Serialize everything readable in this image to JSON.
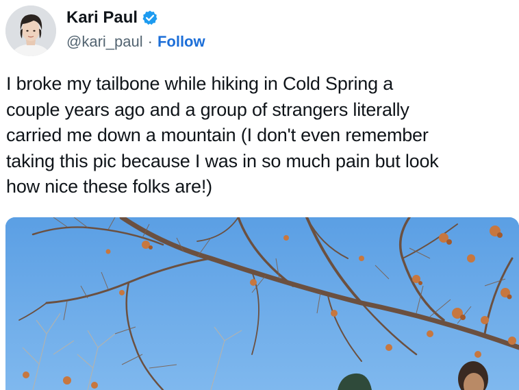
{
  "author": {
    "display_name": "Kari Paul",
    "handle": "@kari_paul",
    "separator": "·",
    "follow_label": "Follow",
    "verified": true,
    "verified_color": "#1d9bf0"
  },
  "tweet": {
    "text_lines": [
      "I broke my tailbone while hiking in Cold Spring a",
      "couple years ago and a group of strangers literally",
      "carried me down a mountain (I don't even remember",
      "taking this pic because I was in so much pain but look",
      "how nice these folks are!)"
    ]
  },
  "colors": {
    "follow_link": "#1d6fd8",
    "text": "#0f1419",
    "secondary_text": "#536471",
    "sky": "#5aa3e6"
  }
}
